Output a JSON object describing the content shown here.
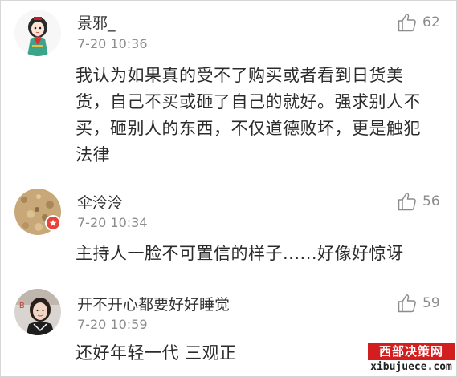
{
  "comments": [
    {
      "username": "景邪_",
      "time": "7-20 10:36",
      "text": "我认为如果真的受不了购买或者看到日货美货，自己不买或砸了自己的就好。强求别人不买，砸别人的东西，不仅道德败坏，更是触犯法律",
      "likes": "62",
      "avatar_icon": "cartoon-girl-avatar"
    },
    {
      "username": "伞泠泠",
      "time": "7-20 10:34",
      "text": "主持人一脸不可置信的样子......好像好惊讶",
      "likes": "56",
      "avatar_icon": "textured-beige-avatar"
    },
    {
      "username": "开不开心都要好好睡觉",
      "time": "7-20 10:59",
      "text": "还好年轻一代 三观正",
      "likes": "59",
      "avatar_icon": "girl-photo-avatar"
    }
  ],
  "watermark": {
    "title": "西部决策网",
    "url": "xibujuece.com"
  },
  "colors": {
    "accent_badge": "#e8423a",
    "watermark_red": "#d21e1e",
    "meta_gray": "#8c8c8c"
  }
}
